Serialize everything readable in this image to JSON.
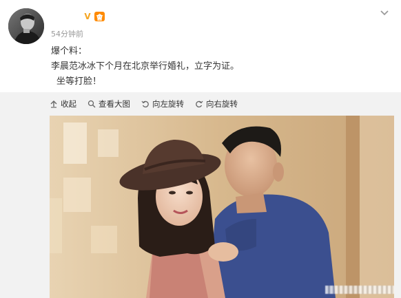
{
  "post": {
    "username": "",
    "verified_icon": "v-verified-icon",
    "vip_icon": "vip-icon",
    "vip_label": "會",
    "time": "54分钟前",
    "text": {
      "line1": "爆个料：",
      "line2": "李晨范冰冰下个月在北京举行婚礼，立字为证。",
      "line3": "坐等打脸！"
    }
  },
  "toolbar": {
    "collapse": "收起",
    "view_large": "查看大图",
    "rotate_left": "向左旋转",
    "rotate_right": "向右旋转"
  },
  "colors": {
    "accent": "#f5a623",
    "vip": "#ff8a00",
    "muted": "#999999",
    "media_bg": "#f2f2f2"
  }
}
